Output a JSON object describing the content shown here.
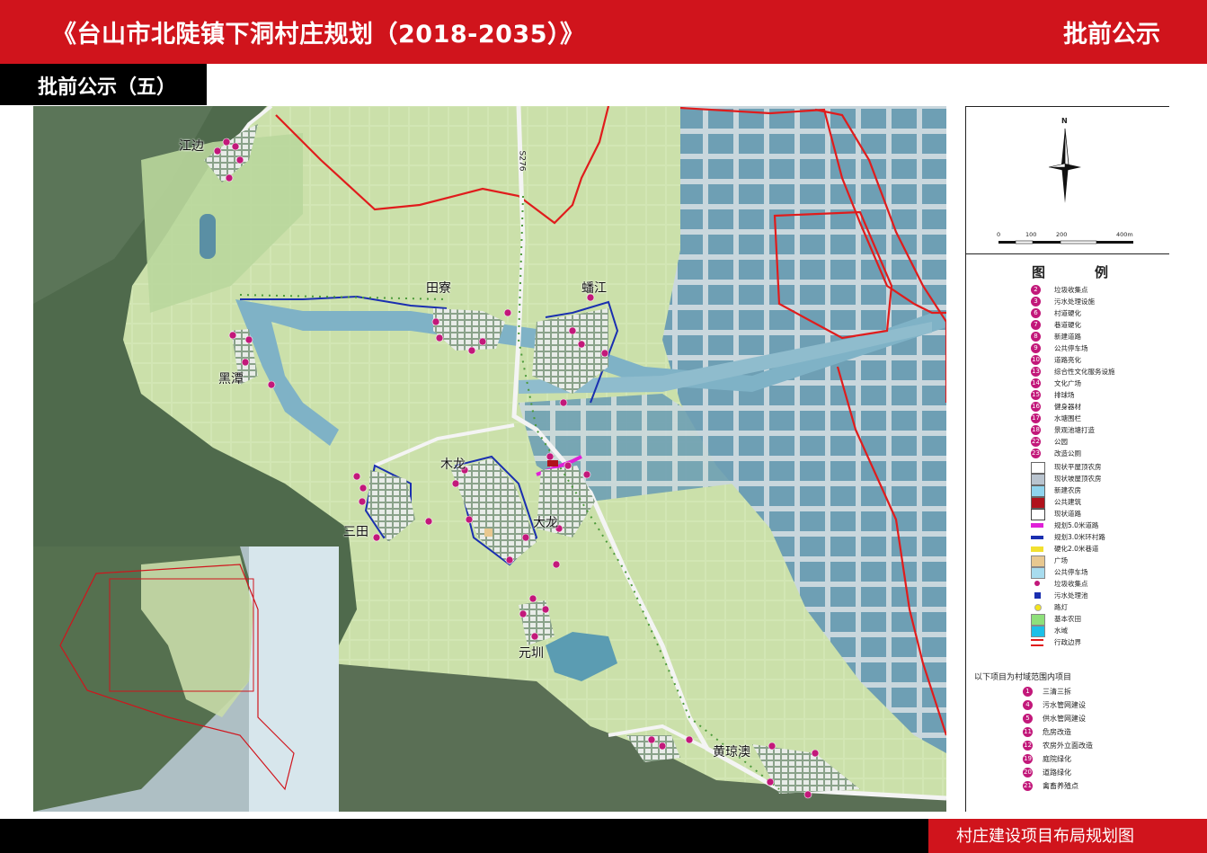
{
  "header": {
    "title": "《台山市北陡镇下洞村庄规划（2018-2035）》",
    "stage": "批前公示",
    "subtitle": "批前公示（五）"
  },
  "footer": {
    "title": "村庄建设项目布局规划图"
  },
  "colors": {
    "brand_red": "#d0141c",
    "marker_magenta": "#c2187a",
    "boundary_red": "#e01c1c",
    "road_blue": "#1a2fb0"
  },
  "map": {
    "road_label": "S276",
    "villages": [
      {
        "name": "江边"
      },
      {
        "name": "田寮"
      },
      {
        "name": "蟠江"
      },
      {
        "name": "黑潭"
      },
      {
        "name": "木龙"
      },
      {
        "name": "大龙"
      },
      {
        "name": "三田"
      },
      {
        "name": "元圳"
      },
      {
        "name": "黄琼澳"
      }
    ],
    "north_label": "N",
    "scale_ticks": [
      "0",
      "100",
      "200",
      "400m"
    ]
  },
  "legend": {
    "heading": "图　例",
    "numbered": [
      {
        "num": "2",
        "label": "垃圾收集点"
      },
      {
        "num": "3",
        "label": "污水处理设施"
      },
      {
        "num": "6",
        "label": "村道硬化"
      },
      {
        "num": "7",
        "label": "巷道硬化"
      },
      {
        "num": "8",
        "label": "新建道路"
      },
      {
        "num": "9",
        "label": "公共停车场"
      },
      {
        "num": "10",
        "label": "道路亮化"
      },
      {
        "num": "13",
        "label": "综合性文化服务设施"
      },
      {
        "num": "14",
        "label": "文化广场"
      },
      {
        "num": "15",
        "label": "排球场"
      },
      {
        "num": "16",
        "label": "健身器材"
      },
      {
        "num": "17",
        "label": "水塘围栏"
      },
      {
        "num": "18",
        "label": "景观池塘打造"
      },
      {
        "num": "22",
        "label": "公园"
      },
      {
        "num": "23",
        "label": "改造公厕"
      }
    ],
    "symbols": [
      {
        "label": "现状平屋顶农房",
        "color": "#ffffff"
      },
      {
        "label": "现状坡屋顶农房",
        "color": "#b9c4cf"
      },
      {
        "label": "新建农房",
        "color": "#8fd4ee"
      },
      {
        "label": "公共建筑",
        "color": "#b0121c"
      },
      {
        "label": "现状道路",
        "color": "#ffffff"
      },
      {
        "label": "规划5.0米道路",
        "color": "#e020d8"
      },
      {
        "label": "规划3.0米环村路",
        "color": "#1a2fb0"
      },
      {
        "label": "硬化2.0米巷道",
        "color": "#f2e030"
      },
      {
        "label": "广场",
        "color": "#e8c890"
      },
      {
        "label": "公共停车场",
        "color": "#a8dcee"
      },
      {
        "label": "垃圾收集点",
        "color": "#c2187a"
      },
      {
        "label": "污水处理池",
        "color": "#1a2fb0"
      },
      {
        "label": "路灯",
        "color": "#f4e41a"
      },
      {
        "label": "基本农田",
        "color": "#8ee07a"
      },
      {
        "label": "水域",
        "color": "#1cc0e8"
      },
      {
        "label": "行政边界",
        "color": "#e01c1c"
      }
    ],
    "village_note": "以下项目为村域范围内项目",
    "village_projects": [
      {
        "num": "1",
        "label": "三清三拆"
      },
      {
        "num": "4",
        "label": "污水管网建设"
      },
      {
        "num": "5",
        "label": "供水管网建设"
      },
      {
        "num": "11",
        "label": "危房改造"
      },
      {
        "num": "12",
        "label": "农房外立面改造"
      },
      {
        "num": "19",
        "label": "庭院绿化"
      },
      {
        "num": "20",
        "label": "道路绿化"
      },
      {
        "num": "21",
        "label": "禽畜养殖点"
      }
    ]
  }
}
